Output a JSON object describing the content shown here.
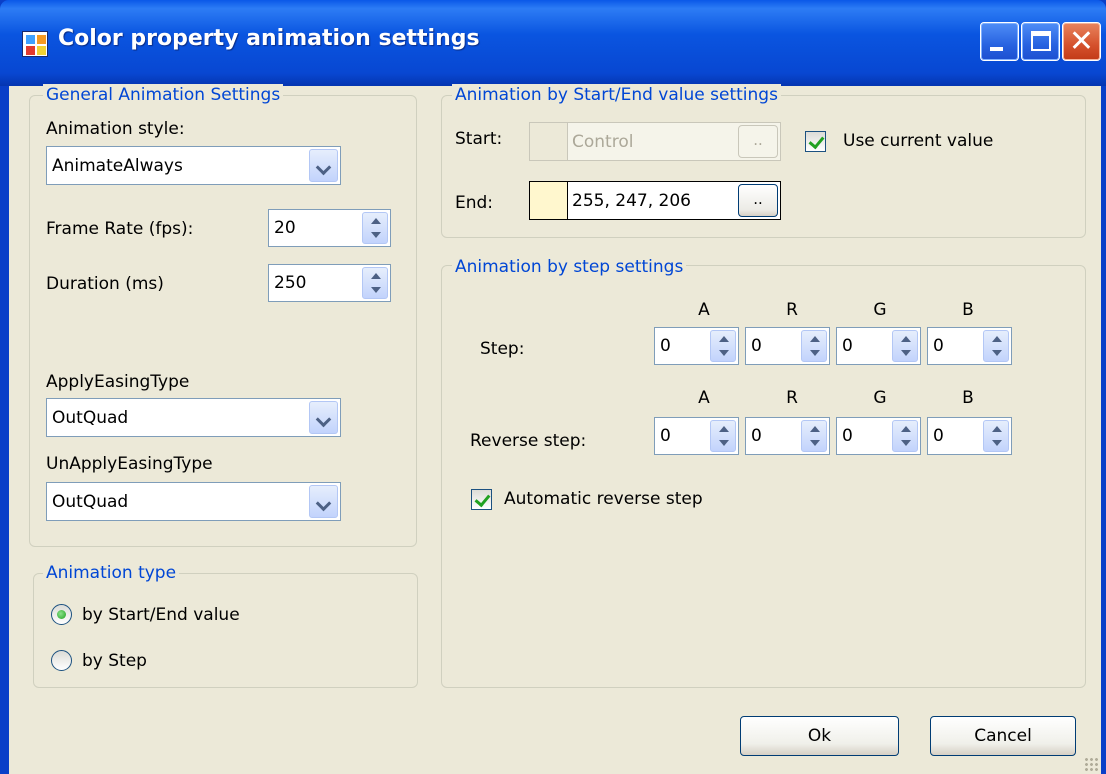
{
  "window": {
    "title": "Color property animation settings"
  },
  "general": {
    "legend": "General Animation Settings",
    "animation_style_label": "Animation style:",
    "animation_style_value": "AnimateAlways",
    "frame_rate_label": "Frame Rate (fps):",
    "frame_rate_value": "20",
    "duration_label": "Duration (ms)",
    "duration_value": "250",
    "apply_easing_label": "ApplyEasingType",
    "apply_easing_value": "OutQuad",
    "unapply_easing_label": "UnApplyEasingType",
    "unapply_easing_value": "OutQuad"
  },
  "animation_type": {
    "legend": "Animation type",
    "option_start_end": "by Start/End value",
    "option_step": "by Step",
    "selected": "by Start/End value"
  },
  "start_end": {
    "legend": "Animation by Start/End value settings",
    "start_label": "Start:",
    "start_value": "Control",
    "start_color": "#ece9d8",
    "use_current_label": "Use  current value",
    "use_current_checked": true,
    "end_label": "End:",
    "end_value": "255, 247, 206",
    "end_color": "#fff7ce",
    "browse_label": ".."
  },
  "step": {
    "legend": "Animation by step settings",
    "channel_headers": [
      "A",
      "R",
      "G",
      "B"
    ],
    "step_label": "Step:",
    "step_values": [
      "0",
      "0",
      "0",
      "0"
    ],
    "reverse_label": "Reverse step:",
    "reverse_values": [
      "0",
      "0",
      "0",
      "0"
    ],
    "auto_reverse_label": "Automatic reverse step",
    "auto_reverse_checked": true
  },
  "footer": {
    "ok_label": "Ok",
    "cancel_label": "Cancel"
  }
}
